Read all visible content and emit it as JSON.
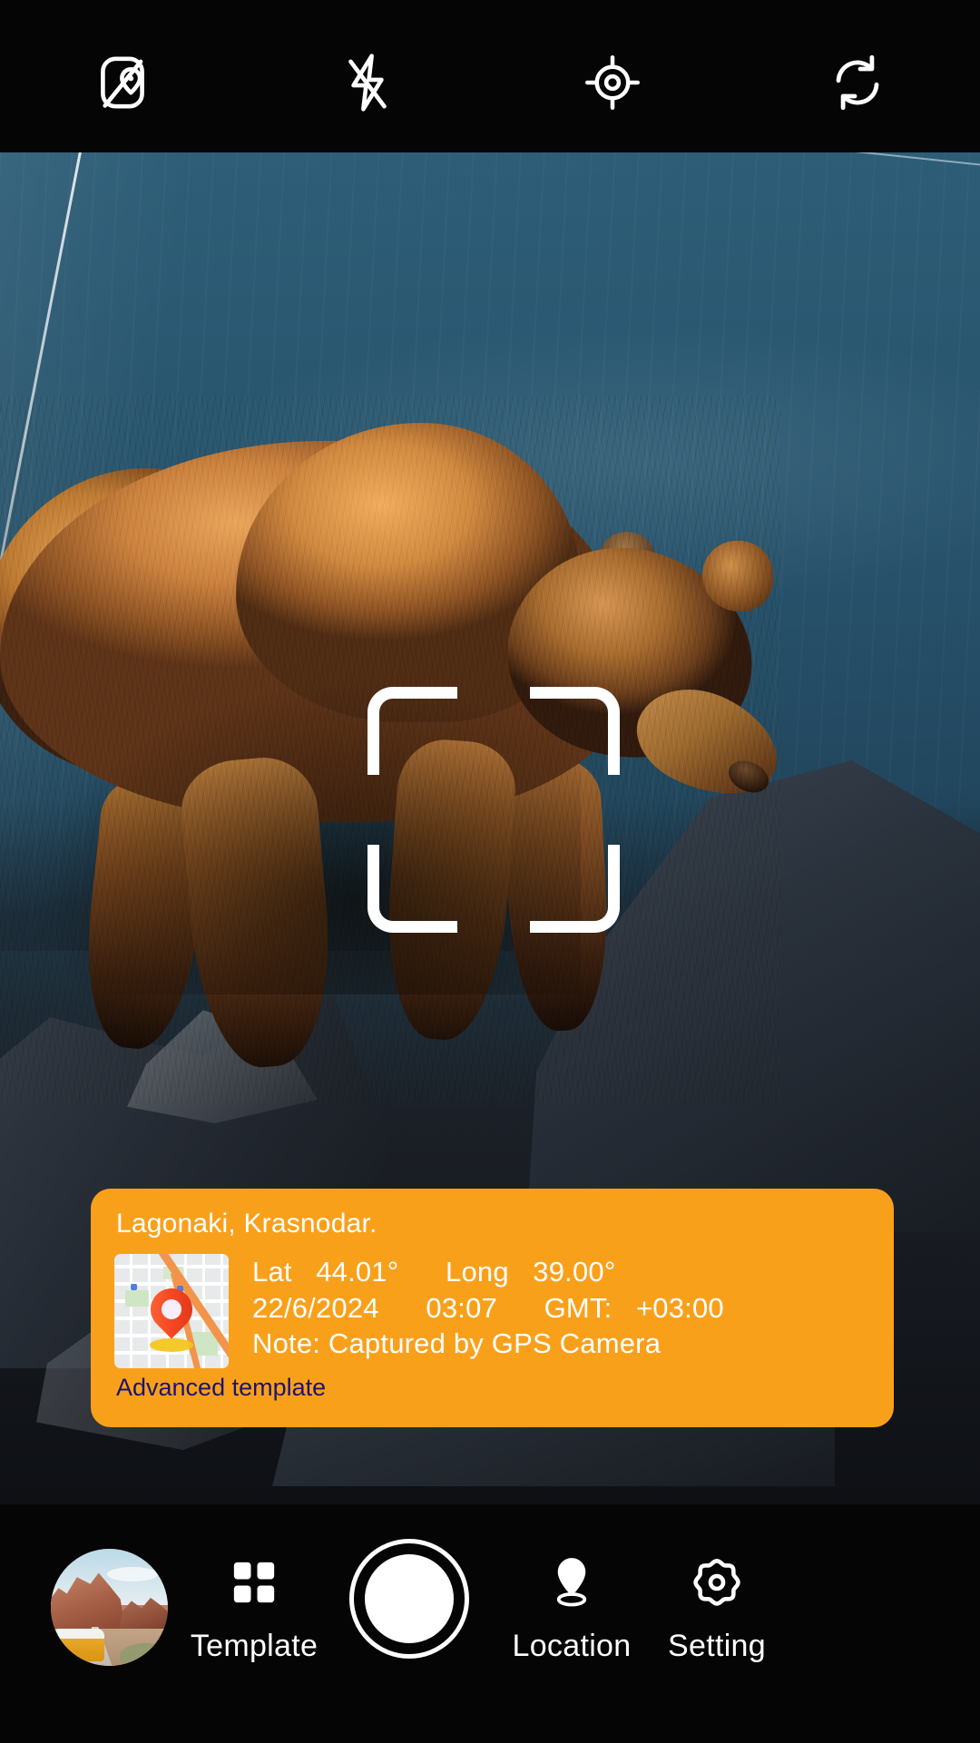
{
  "app": {
    "name": "GPS Camera"
  },
  "topbar": {
    "items": [
      {
        "name": "map-off-icon",
        "label": "Map overlay off"
      },
      {
        "name": "flash-off-icon",
        "label": "Flash off"
      },
      {
        "name": "crosshair-icon",
        "label": "Focus lock"
      },
      {
        "name": "camera-flip-icon",
        "label": "Switch camera"
      }
    ]
  },
  "viewfinder": {
    "focus_bracket": "focus-bracket",
    "subject": "Brown bear on rocky shoreline by blue water"
  },
  "gps_card": {
    "place": "Lagonaki, Krasnodar.",
    "lat_label": "Lat",
    "lat_value": "44.01°",
    "long_label": "Long",
    "long_value": "39.00°",
    "date": "22/6/2024",
    "time": "03:07",
    "gmt_label": "GMT:",
    "gmt_value": "+03:00",
    "note": "Note: Captured by GPS Camera",
    "advanced_template": "Advanced template",
    "map_thumbnail": "map-thumbnail",
    "colors": {
      "card_background": "#F9A01B",
      "text": "#FFFFFF",
      "advanced_link": "#1B1470",
      "pin": "#F4451F",
      "pin_shadow": "#F5C518"
    }
  },
  "bottombar": {
    "gallery": {
      "name": "gallery-thumbnail",
      "label": "Gallery"
    },
    "template": {
      "label": "Template",
      "icon": "grid-icon"
    },
    "shutter": {
      "label": "Shutter",
      "icon": "shutter-button"
    },
    "location": {
      "label": "Location",
      "icon": "location-pin-icon"
    },
    "setting": {
      "label": "Setting",
      "icon": "gear-icon"
    }
  }
}
